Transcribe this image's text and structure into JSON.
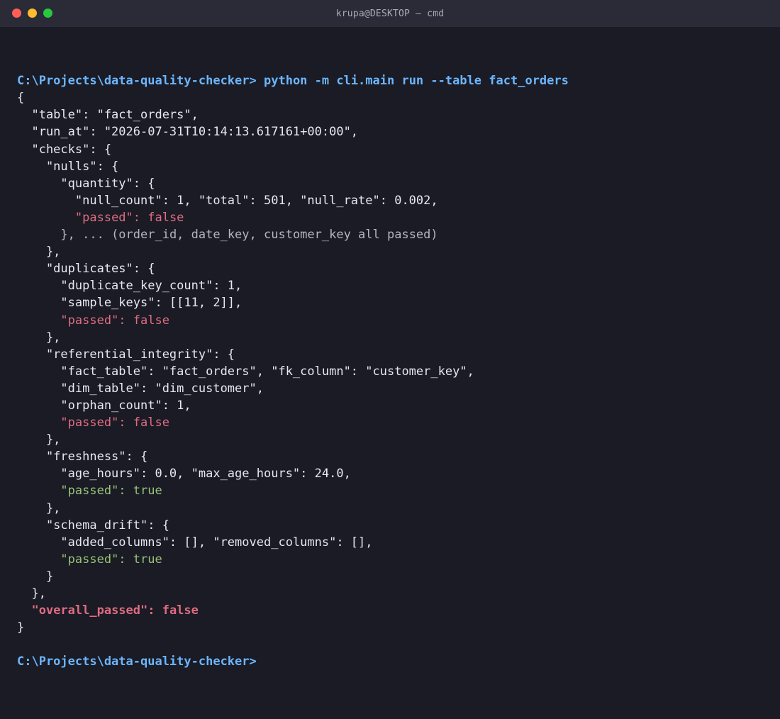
{
  "window": {
    "title": "krupa@DESKTOP  —  cmd"
  },
  "terminal": {
    "prompt": "C:\\Projects\\data-quality-checker>",
    "command": " python -m cli.main run --table fact_orders",
    "lines": [
      "{",
      "  \"table\": \"fact_orders\",",
      "  \"run_at\": \"2026-07-31T10:14:13.617161+00:00\",",
      "  \"checks\": {",
      "    \"nulls\": {",
      "      \"quantity\": {",
      "        \"null_count\": 1, \"total\": 501, \"null_rate\": 0.002,",
      "        \"passed\": false",
      "      }, ... (order_id, date_key, customer_key all passed)",
      "    },",
      "    \"duplicates\": {",
      "      \"duplicate_key_count\": 1,",
      "      \"sample_keys\": [[11, 2]],",
      "      \"passed\": false",
      "    },",
      "    \"referential_integrity\": {",
      "      \"fact_table\": \"fact_orders\", \"fk_column\": \"customer_key\",",
      "      \"dim_table\": \"dim_customer\",",
      "      \"orphan_count\": 1,",
      "      \"passed\": false",
      "    },",
      "    \"freshness\": {",
      "      \"age_hours\": 0.0, \"max_age_hours\": 24.0,",
      "      \"passed\": true",
      "    },",
      "    \"schema_drift\": {",
      "      \"added_columns\": [], \"removed_columns\": [],",
      "      \"passed\": true",
      "    }",
      "  },",
      "  \"overall_passed\": false",
      "}",
      ""
    ],
    "line_styles": [
      "",
      "",
      "",
      "",
      "",
      "",
      "",
      "fail",
      "muted",
      "",
      "",
      "",
      "",
      "fail",
      "",
      "",
      "",
      "",
      "",
      "fail",
      "",
      "",
      "",
      "pass",
      "",
      "",
      "",
      "pass",
      "",
      "",
      "bold-fail",
      "",
      ""
    ],
    "final_prompt": "C:\\Projects\\data-quality-checker>"
  },
  "colors": {
    "background": "#1a1b24",
    "titlebar": "#2a2b36",
    "prompt": "#6cb6ff",
    "fail": "#e06c82",
    "pass": "#98c379"
  }
}
